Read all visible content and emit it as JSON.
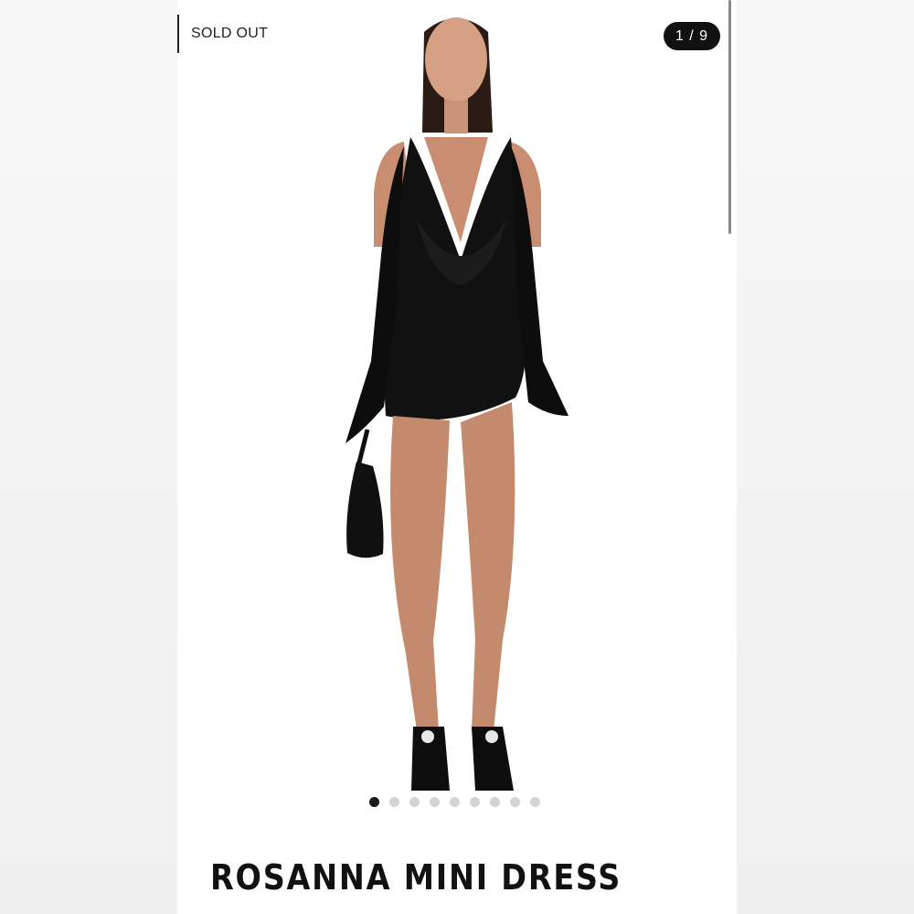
{
  "product": {
    "badge": "SOLD OUT",
    "counter": "1 / 9",
    "title": "ROSANNA MINI DRESS"
  },
  "gallery": {
    "current_index": 1,
    "total_images": 9,
    "image_icon": "model-full-body-photo"
  },
  "colors": {
    "badge_bg": "#111111",
    "dress": "#111111",
    "accent": "#000000"
  }
}
